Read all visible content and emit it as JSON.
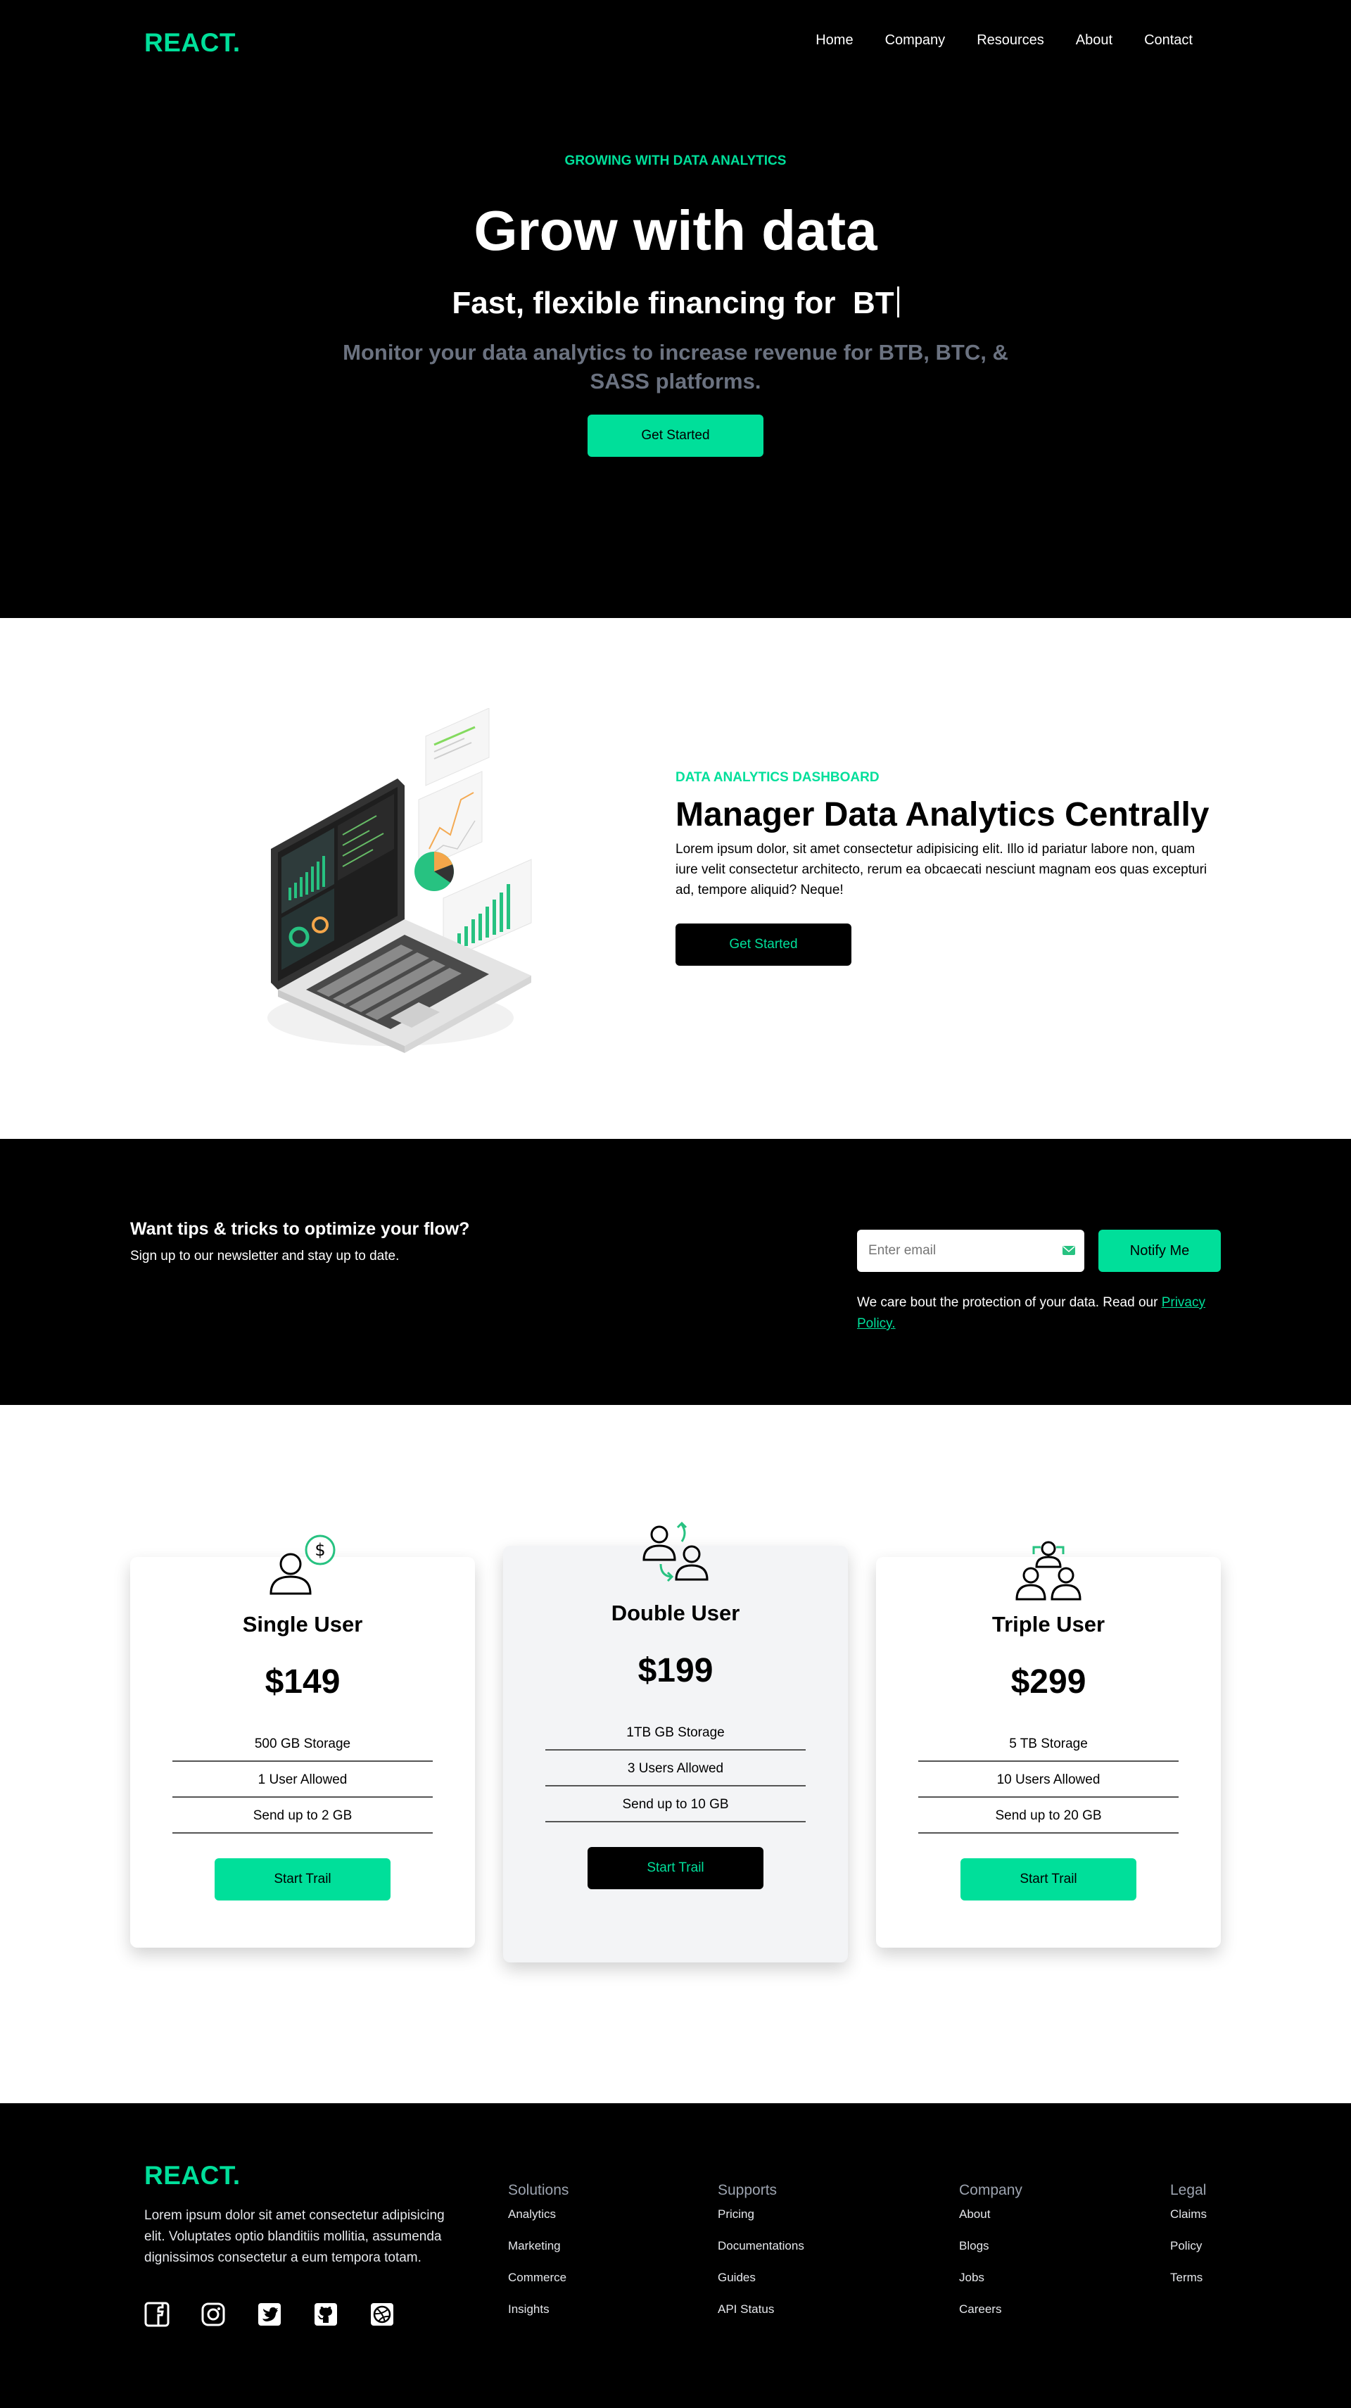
{
  "brand": {
    "logo": "REACT.",
    "accent": "#00df9a"
  },
  "nav": {
    "items": [
      "Home",
      "Company",
      "Resources",
      "About",
      "Contact"
    ]
  },
  "hero": {
    "eyebrow": "GROWING WITH DATA ANALYTICS",
    "title": "Grow with data",
    "typed_prefix": "Fast, flexible financing for",
    "typed_word": "BT",
    "subtitle": "Monitor your data analytics to increase revenue for BTB, BTC, & SASS platforms.",
    "cta": "Get Started"
  },
  "analytics": {
    "eyebrow": "DATA ANALYTICS DASHBOARD",
    "title": "Manager Data Analytics Centrally",
    "body": "Lorem ipsum dolor, sit amet consectetur adipisicing elit. Illo id pariatur labore non, quam iure velit consectetur architecto, rerum ea obcaecati nesciunt magnam eos quas excepturi ad, tempore aliquid? Neque!",
    "cta": "Get Started",
    "illustration_icon": "laptop-analytics-illustration"
  },
  "newsletter": {
    "title": "Want tips & tricks to optimize your flow?",
    "subtitle": "Sign up to our newsletter and stay up to date.",
    "email_placeholder": "Enter email",
    "button": "Notify Me",
    "privacy_text": "We care bout the protection of your data. Read our",
    "privacy_link": "Privacy Policy."
  },
  "pricing": {
    "plans": [
      {
        "name": "Single User",
        "price": "$149",
        "features": [
          "500 GB Storage",
          "1 User Allowed",
          "Send up to 2 GB"
        ],
        "button": "Start Trail",
        "icon": "user-dollar-icon"
      },
      {
        "name": "Double User",
        "price": "$199",
        "features": [
          "1TB GB Storage",
          "3 Users Allowed",
          "Send up to 10 GB"
        ],
        "button": "Start Trail",
        "icon": "users-exchange-icon"
      },
      {
        "name": "Triple User",
        "price": "$299",
        "features": [
          "5 TB Storage",
          "10 Users Allowed",
          "Send up to 20 GB"
        ],
        "button": "Start Trail",
        "icon": "users-group-icon"
      }
    ]
  },
  "footer": {
    "logo": "REACT.",
    "about": "Lorem ipsum dolor sit amet consectetur adipisicing elit. Voluptates optio blanditiis mollitia, assumenda dignissimos consectetur a eum tempora totam.",
    "socials": [
      "facebook-icon",
      "instagram-icon",
      "twitter-icon",
      "github-icon",
      "dribbble-icon"
    ],
    "columns": [
      {
        "title": "Solutions",
        "links": [
          "Analytics",
          "Marketing",
          "Commerce",
          "Insights"
        ]
      },
      {
        "title": "Supports",
        "links": [
          "Pricing",
          "Documentations",
          "Guides",
          "API Status"
        ]
      },
      {
        "title": "Company",
        "links": [
          "About",
          "Blogs",
          "Jobs",
          "Careers"
        ]
      },
      {
        "title": "Legal",
        "links": [
          "Claims",
          "Policy",
          "Terms"
        ]
      }
    ]
  }
}
